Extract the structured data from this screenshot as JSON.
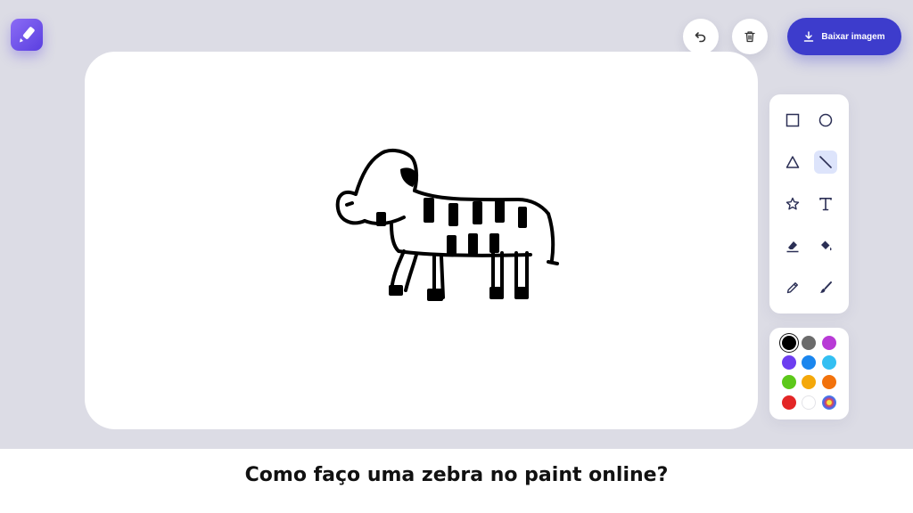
{
  "app": {
    "logo_icon": "brush-logo-icon"
  },
  "toolbar": {
    "undo_icon": "undo-icon",
    "clear_icon": "trash-icon",
    "download_label": "Baixar imagem",
    "download_icon": "download-icon"
  },
  "tools": [
    {
      "name": "rectangle",
      "icon": "square-icon"
    },
    {
      "name": "circle",
      "icon": "circle-icon"
    },
    {
      "name": "triangle",
      "icon": "triangle-icon"
    },
    {
      "name": "line",
      "icon": "line-icon",
      "active": true
    },
    {
      "name": "star",
      "icon": "star-icon"
    },
    {
      "name": "text",
      "icon": "text-icon"
    },
    {
      "name": "eraser",
      "icon": "eraser-icon"
    },
    {
      "name": "fill",
      "icon": "paint-bucket-icon"
    },
    {
      "name": "pencil",
      "icon": "pencil-icon"
    },
    {
      "name": "brush",
      "icon": "brush-icon"
    }
  ],
  "colors": {
    "selected": "#000000",
    "swatches": [
      "#000000",
      "#6b6b6b",
      "#b83ad6",
      "#6d3df0",
      "#1a86ee",
      "#33bff2",
      "#5cc81a",
      "#f4a80a",
      "#f2720c",
      "#e32626",
      "#ffffff",
      "rainbow"
    ]
  },
  "caption": "Como faço uma zebra no paint online?"
}
